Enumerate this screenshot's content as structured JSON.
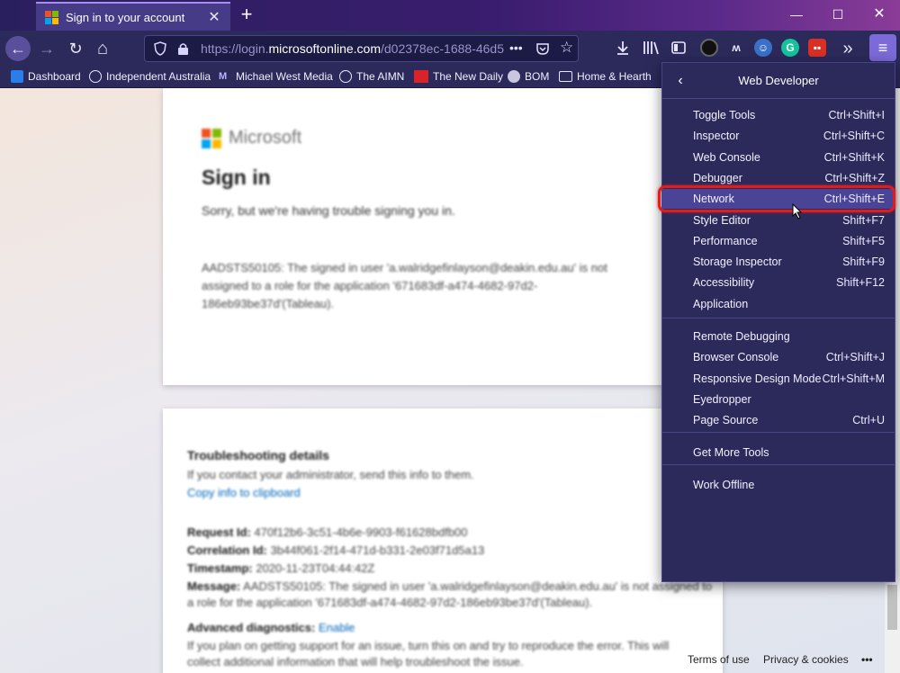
{
  "tab": {
    "title": "Sign in to your account",
    "close": "✕",
    "new_tab": "+"
  },
  "window_controls": {
    "minimize": "—",
    "maximize": "☐",
    "close": "✕"
  },
  "nav": {
    "back": "←",
    "forward": "→",
    "reload": "↻",
    "home": "⌂",
    "url_prefix": "https://login.",
    "url_host": "microsoftonline.com",
    "url_rest": "/d02378ec-1688-46d5",
    "url_more": "•••",
    "overflow": "»",
    "menu": "≡"
  },
  "bookmarks": [
    {
      "label": "Dashboard",
      "icon": "home-icon"
    },
    {
      "label": "Independent Australia",
      "icon": "globe-icon"
    },
    {
      "label": "Michael West Media",
      "icon": "mw-logo-icon"
    },
    {
      "label": "The AIMN",
      "icon": "globe-icon"
    },
    {
      "label": "The New Daily",
      "icon": "tnd-logo-icon"
    },
    {
      "label": "BOM",
      "icon": "bom-logo-icon"
    },
    {
      "label": "Home & Hearth",
      "icon": "folder-icon"
    }
  ],
  "signin": {
    "brand": "Microsoft",
    "title": "Sign in",
    "subtitle": "Sorry, but we're having trouble signing you in.",
    "error": "AADSTS50105: The signed in user 'a.walridgefinlayson@deakin.edu.au' is not assigned to a role for the application '671683df-a474-4682-97d2-186eb93be37d'(Tableau)."
  },
  "troubleshooting": {
    "title": "Troubleshooting details",
    "contact": "If you contact your administrator, send this info to them.",
    "copy_link": "Copy info to clipboard",
    "request_key": "Request Id:",
    "request_val": "470f12b6-3c51-4b6e-9903-f61628bdfb00",
    "correlation_key": "Correlation Id:",
    "correlation_val": "3b44f061-2f14-471d-b331-2e03f71d5a13",
    "timestamp_key": "Timestamp:",
    "timestamp_val": "2020-11-23T04:44:42Z",
    "message_key": "Message:",
    "message_val": "AADSTS50105: The signed in user 'a.walridgefinlayson@deakin.edu.au' is not assigned to",
    "message_val2": "a role for the application '671683df-a474-4682-97d2-186eb93be37d'(Tableau).",
    "adv_key": "Advanced diagnostics:",
    "adv_link": "Enable",
    "adv_text": "If you plan on getting support for an issue, turn this on and try to reproduce the error. This will",
    "adv_text2": "collect additional information that will help troubleshoot the issue."
  },
  "footer": {
    "terms": "Terms of use",
    "privacy": "Privacy & cookies",
    "more": "•••"
  },
  "devmenu": {
    "back": "‹",
    "title": "Web Developer",
    "group1": [
      {
        "label": "Toggle Tools",
        "shortcut": "Ctrl+Shift+I"
      },
      {
        "label": "Inspector",
        "shortcut": "Ctrl+Shift+C"
      },
      {
        "label": "Web Console",
        "shortcut": "Ctrl+Shift+K"
      },
      {
        "label": "Debugger",
        "shortcut": "Ctrl+Shift+Z"
      },
      {
        "label": "Network",
        "shortcut": "Ctrl+Shift+E"
      },
      {
        "label": "Style Editor",
        "shortcut": "Shift+F7"
      },
      {
        "label": "Performance",
        "shortcut": "Shift+F5"
      },
      {
        "label": "Storage Inspector",
        "shortcut": "Shift+F9"
      },
      {
        "label": "Accessibility",
        "shortcut": "Shift+F12"
      },
      {
        "label": "Application",
        "shortcut": ""
      }
    ],
    "group2": [
      {
        "label": "Remote Debugging",
        "shortcut": ""
      },
      {
        "label": "Browser Console",
        "shortcut": "Ctrl+Shift+J"
      },
      {
        "label": "Responsive Design Mode",
        "shortcut": "Ctrl+Shift+M"
      },
      {
        "label": "Eyedropper",
        "shortcut": ""
      },
      {
        "label": "Page Source",
        "shortcut": "Ctrl+U"
      }
    ],
    "group3": [
      {
        "label": "Get More Tools",
        "shortcut": ""
      }
    ],
    "group4": [
      {
        "label": "Work Offline",
        "shortcut": ""
      }
    ],
    "highlighted": "Network"
  },
  "colors": {
    "highlight": "#e01c1c",
    "menu_bg": "#2b2a5b",
    "accent": "#7c6ad8"
  }
}
